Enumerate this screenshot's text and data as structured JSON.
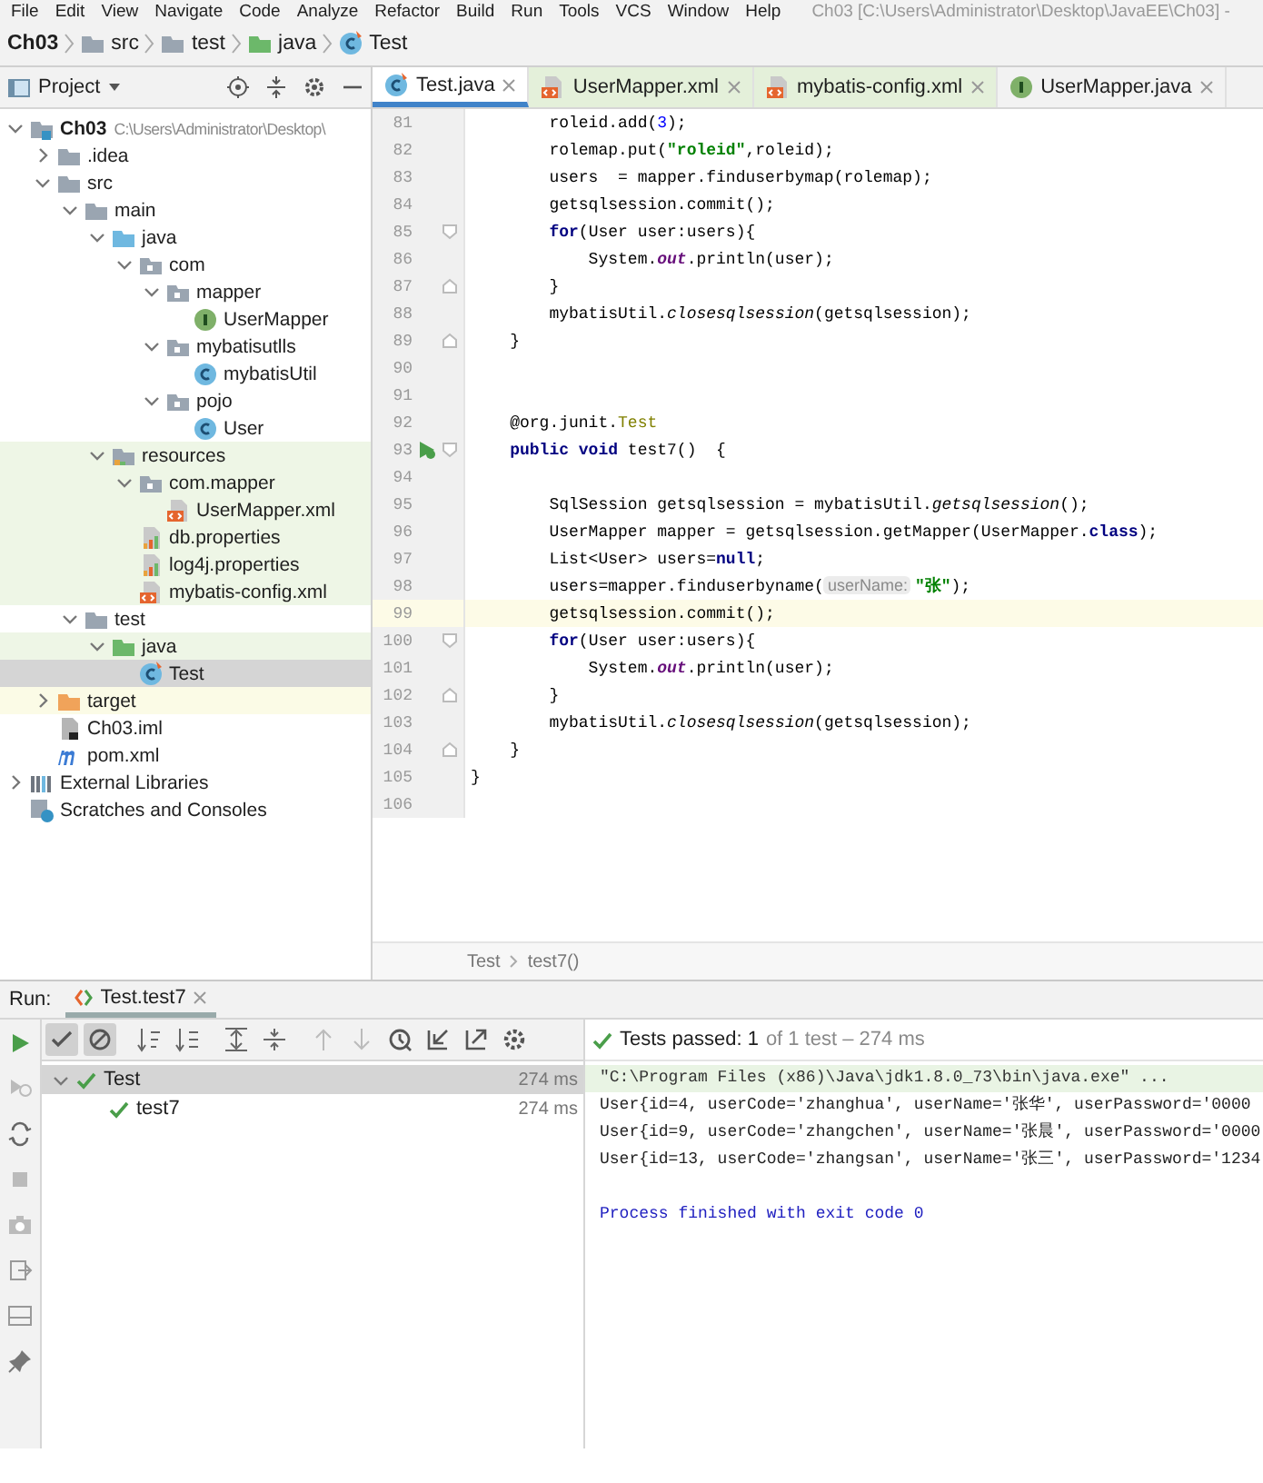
{
  "menu_bar": {
    "items": [
      "File",
      "Edit",
      "View",
      "Navigate",
      "Code",
      "Analyze",
      "Refactor",
      "Build",
      "Run",
      "Tools",
      "VCS",
      "Window",
      "Help"
    ],
    "title": "Ch03 [C:\\Users\\Administrator\\Desktop\\JavaEE\\Ch03] -"
  },
  "navigation_bar": {
    "crumbs": [
      {
        "label": "Ch03",
        "kind": "module"
      },
      {
        "label": "src",
        "kind": "folder"
      },
      {
        "label": "test",
        "kind": "folder"
      },
      {
        "label": "java",
        "kind": "test-folder"
      },
      {
        "label": "Test",
        "kind": "test-class"
      }
    ]
  },
  "project_panel": {
    "title": "Project",
    "tree": [
      {
        "label": "Ch03",
        "kind": "module",
        "path": "C:\\Users\\Administrator\\Desktop\\",
        "expanded": true,
        "selected": false,
        "children": [
          {
            "label": ".idea",
            "kind": "folder",
            "expanded": false,
            "selected": false
          },
          {
            "label": "src",
            "kind": "folder",
            "expanded": true,
            "selected": false,
            "children": [
              {
                "label": "main",
                "kind": "folder",
                "expanded": true,
                "selected": false,
                "children": [
                  {
                    "label": "java",
                    "kind": "source-folder",
                    "expanded": true,
                    "selected": false,
                    "children": [
                      {
                        "label": "com",
                        "kind": "package",
                        "expanded": true,
                        "selected": false,
                        "children": [
                          {
                            "label": "mapper",
                            "kind": "package",
                            "expanded": true,
                            "selected": false,
                            "children": [
                              {
                                "label": "UserMapper",
                                "kind": "interface",
                                "selected": false
                              }
                            ]
                          },
                          {
                            "label": "mybatisutlls",
                            "kind": "package",
                            "expanded": true,
                            "selected": false,
                            "children": [
                              {
                                "label": "mybatisUtil",
                                "kind": "class",
                                "selected": false
                              }
                            ]
                          },
                          {
                            "label": "pojo",
                            "kind": "package",
                            "expanded": true,
                            "selected": false,
                            "children": [
                              {
                                "label": "User",
                                "kind": "class",
                                "selected": false
                              }
                            ]
                          }
                        ]
                      }
                    ]
                  },
                  {
                    "label": "resources",
                    "kind": "resource-folder",
                    "expanded": true,
                    "selected": false,
                    "color": "#eef6e6",
                    "children": [
                      {
                        "label": "com.mapper",
                        "kind": "package",
                        "expanded": true,
                        "selected": false,
                        "color": "#eef6e6",
                        "children": [
                          {
                            "label": "UserMapper.xml",
                            "kind": "xml",
                            "selected": false,
                            "color": "#eef6e6"
                          }
                        ]
                      },
                      {
                        "label": "db.properties",
                        "kind": "properties",
                        "selected": false,
                        "color": "#eef6e6"
                      },
                      {
                        "label": "log4j.properties",
                        "kind": "properties",
                        "selected": false,
                        "color": "#eef6e6"
                      },
                      {
                        "label": "mybatis-config.xml",
                        "kind": "xml",
                        "selected": false,
                        "color": "#eef6e6"
                      }
                    ]
                  }
                ]
              },
              {
                "label": "test",
                "kind": "folder",
                "expanded": true,
                "selected": false,
                "children": [
                  {
                    "label": "java",
                    "kind": "test-folder",
                    "expanded": true,
                    "selected": false,
                    "color": "#eef6e6",
                    "children": [
                      {
                        "label": "Test",
                        "kind": "test-class",
                        "selected": true
                      }
                    ]
                  }
                ]
              }
            ]
          },
          {
            "label": "target",
            "kind": "excluded-folder",
            "expanded": false,
            "selected": false,
            "color": "#fbfbe6"
          },
          {
            "label": "Ch03.iml",
            "kind": "iml",
            "selected": false
          },
          {
            "label": "pom.xml",
            "kind": "maven",
            "selected": false
          }
        ]
      },
      {
        "label": "External Libraries",
        "kind": "libraries",
        "expanded": false,
        "selected": false
      },
      {
        "label": "Scratches and Consoles",
        "kind": "scratches",
        "selected": false
      }
    ]
  },
  "editor": {
    "tabs": [
      {
        "label": "Test.java",
        "kind": "test-class",
        "selected": true
      },
      {
        "label": "UserMapper.xml",
        "kind": "xml",
        "selected": false,
        "color": "#e4f0da"
      },
      {
        "label": "mybatis-config.xml",
        "kind": "xml",
        "selected": false,
        "color": "#e4f0da"
      },
      {
        "label": "UserMapper.java",
        "kind": "interface",
        "selected": false
      }
    ],
    "lines": [
      {
        "number": "81",
        "segments": [
          {
            "kind": "plain",
            "text": "        roleid.add("
          },
          {
            "kind": "number",
            "text": "3"
          },
          {
            "kind": "plain",
            "text": ");"
          }
        ]
      },
      {
        "number": "82",
        "segments": [
          {
            "kind": "plain",
            "text": "        rolemap.put("
          },
          {
            "kind": "string",
            "text": "\"roleid\""
          },
          {
            "kind": "plain",
            "text": ",roleid);"
          }
        ]
      },
      {
        "number": "83",
        "segments": [
          {
            "kind": "plain",
            "text": "        users  = mapper.finduserbymap(rolemap);"
          }
        ]
      },
      {
        "number": "84",
        "segments": [
          {
            "kind": "plain",
            "text": "        getsqlsession.commit();"
          }
        ]
      },
      {
        "number": "85",
        "fold_start": true,
        "segments": [
          {
            "kind": "keyword",
            "text": "        for"
          },
          {
            "kind": "plain",
            "text": "(User user:users){"
          }
        ]
      },
      {
        "number": "86",
        "segments": [
          {
            "kind": "plain",
            "text": "            System."
          },
          {
            "kind": "field",
            "text": "out"
          },
          {
            "kind": "plain",
            "text": ".println(user);"
          }
        ]
      },
      {
        "number": "87",
        "fold_end": true,
        "segments": [
          {
            "kind": "plain",
            "text": "        }"
          }
        ]
      },
      {
        "number": "88",
        "segments": [
          {
            "kind": "plain",
            "text": "        mybatisUtil."
          },
          {
            "kind": "static",
            "text": "closesqlsession"
          },
          {
            "kind": "plain",
            "text": "(getsqlsession);"
          }
        ]
      },
      {
        "number": "89",
        "fold_end": true,
        "segments": [
          {
            "kind": "plain",
            "text": "    }"
          }
        ]
      },
      {
        "number": "90"
      },
      {
        "number": "91"
      },
      {
        "number": "92",
        "segments": [
          {
            "kind": "plain",
            "text": "    @org.junit."
          },
          {
            "kind": "annotation",
            "text": "Test"
          }
        ]
      },
      {
        "number": "93",
        "fold_start": true,
        "run_icon": true,
        "segments": [
          {
            "kind": "keyword",
            "text": "    public void"
          },
          {
            "kind": "plain",
            "text": " test7()  {"
          }
        ]
      },
      {
        "number": "94"
      },
      {
        "number": "95",
        "segments": [
          {
            "kind": "plain",
            "text": "        SqlSession getsqlsession = mybatisUtil."
          },
          {
            "kind": "static",
            "text": "getsqlsession"
          },
          {
            "kind": "plain",
            "text": "();"
          }
        ]
      },
      {
        "number": "96",
        "segments": [
          {
            "kind": "plain",
            "text": "        UserMapper mapper = getsqlsession.getMapper(UserMapper."
          },
          {
            "kind": "keyword",
            "text": "class"
          },
          {
            "kind": "plain",
            "text": ");"
          }
        ]
      },
      {
        "number": "97",
        "segments": [
          {
            "kind": "plain",
            "text": "        List<User> users="
          },
          {
            "kind": "keyword",
            "text": "null"
          },
          {
            "kind": "plain",
            "text": ";"
          }
        ]
      },
      {
        "number": "98",
        "segments": [
          {
            "kind": "plain",
            "text": "        users=mapper.finduserbyname("
          },
          {
            "kind": "hint",
            "text": "userName:"
          },
          {
            "kind": "string",
            "text": "\"张\""
          },
          {
            "kind": "plain",
            "text": ");"
          }
        ]
      },
      {
        "number": "99",
        "current": true,
        "segments": [
          {
            "kind": "plain",
            "text": "        getsqlsession.commit();"
          }
        ]
      },
      {
        "number": "100",
        "fold_start": true,
        "segments": [
          {
            "kind": "keyword",
            "text": "        for"
          },
          {
            "kind": "plain",
            "text": "(User user:users){"
          }
        ]
      },
      {
        "number": "101",
        "segments": [
          {
            "kind": "plain",
            "text": "            System."
          },
          {
            "kind": "field",
            "text": "out"
          },
          {
            "kind": "plain",
            "text": ".println(user);"
          }
        ]
      },
      {
        "number": "102",
        "fold_end": true,
        "segments": [
          {
            "kind": "plain",
            "text": "        }"
          }
        ]
      },
      {
        "number": "103",
        "segments": [
          {
            "kind": "plain",
            "text": "        mybatisUtil."
          },
          {
            "kind": "static",
            "text": "closesqlsession"
          },
          {
            "kind": "plain",
            "text": "(getsqlsession);"
          }
        ]
      },
      {
        "number": "104",
        "fold_end": true,
        "segments": [
          {
            "kind": "plain",
            "text": "    }"
          }
        ]
      },
      {
        "number": "105",
        "segments": [
          {
            "kind": "plain",
            "text": "}"
          }
        ]
      },
      {
        "number": "106"
      }
    ],
    "breadcrumbs": [
      "Test",
      "test7()"
    ]
  },
  "run_panel": {
    "label": "Run:",
    "tab": "Test.test7",
    "status": "Tests passed: 1",
    "status_detail": "of 1 test – 274 ms",
    "tests": [
      {
        "label": "Test",
        "time": "274 ms",
        "passed": true,
        "expanded": true,
        "selected": true,
        "children": [
          {
            "label": "test7",
            "time": "274 ms",
            "passed": true,
            "selected": false
          }
        ]
      }
    ],
    "console": [
      {
        "kind": "command",
        "text": "\"C:\\Program Files (x86)\\Java\\jdk1.8.0_73\\bin\\java.exe\" ..."
      },
      {
        "kind": "output",
        "text": "User{id=4, userCode='zhanghua', userName='张华', userPassword='0000"
      },
      {
        "kind": "output",
        "text": "User{id=9, userCode='zhangchen', userName='张晨', userPassword='0000"
      },
      {
        "kind": "output",
        "text": "User{id=13, userCode='zhangsan', userName='张三', userPassword='1234"
      },
      {
        "kind": "blank"
      },
      {
        "kind": "exit",
        "text": "Process finished with exit code 0"
      }
    ]
  }
}
